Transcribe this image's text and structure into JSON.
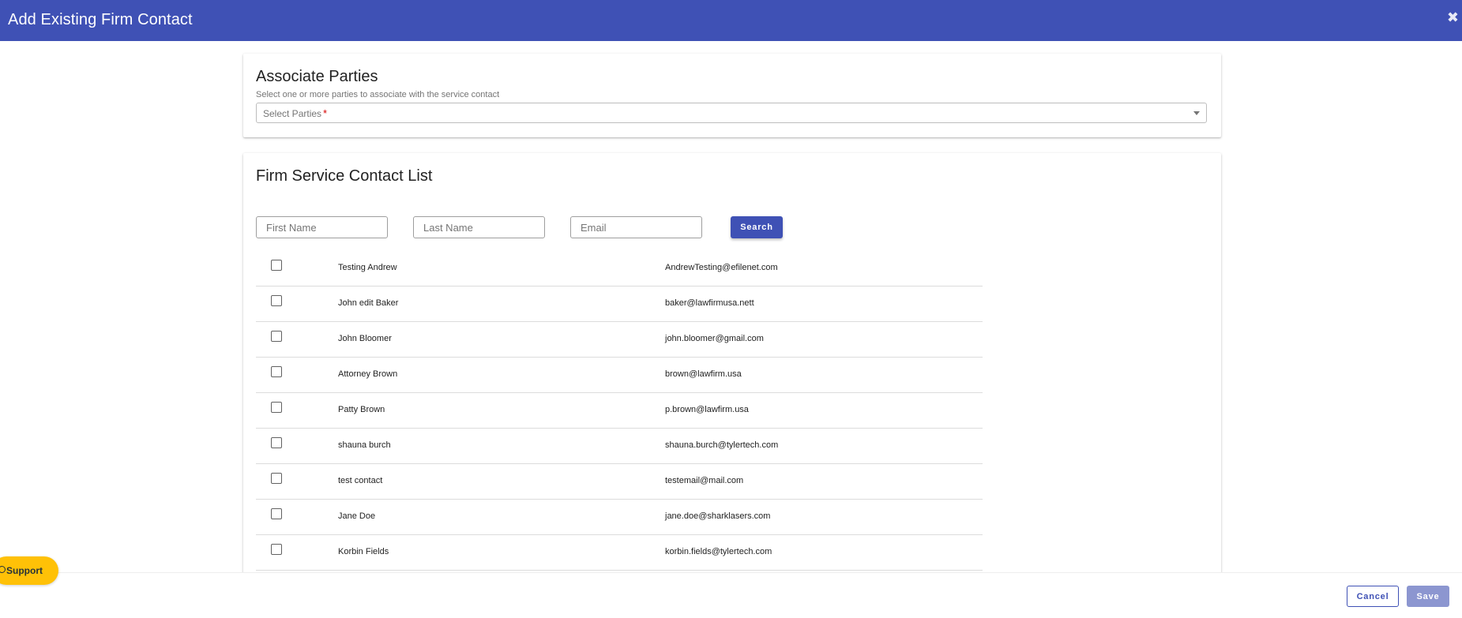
{
  "header": {
    "title": "Add Existing Firm Contact",
    "close_icon": "✖"
  },
  "associate": {
    "title": "Associate Parties",
    "hint": "Select one or more parties to associate with the service contact",
    "select_placeholder": "Select Parties",
    "required_mark": "*"
  },
  "contacts": {
    "title": "Firm Service Contact List",
    "first_name_placeholder": "First Name",
    "last_name_placeholder": "Last Name",
    "email_placeholder": "Email",
    "search_label": "Search",
    "rows": [
      {
        "name": "Testing Andrew",
        "email": "AndrewTesting@efilenet.com"
      },
      {
        "name": "John edit Baker",
        "email": "baker@lawfirmusa.nett"
      },
      {
        "name": "John Bloomer",
        "email": "john.bloomer@gmail.com"
      },
      {
        "name": "Attorney Brown",
        "email": "brown@lawfirm.usa"
      },
      {
        "name": "Patty Brown",
        "email": "p.brown@lawfirm.usa"
      },
      {
        "name": "shauna burch",
        "email": "shauna.burch@tylertech.com"
      },
      {
        "name": "test contact",
        "email": "testemail@mail.com"
      },
      {
        "name": "Jane Doe",
        "email": "jane.doe@sharklasers.com"
      },
      {
        "name": "Korbin Fields",
        "email": "korbin.fields@tylertech.com"
      }
    ]
  },
  "footer": {
    "support_label": "Support",
    "cancel_label": "Cancel",
    "save_label": "Save"
  },
  "colors": {
    "primary": "#3f51b5",
    "save_disabled": "#8c96d0",
    "support": "#ffc107"
  }
}
